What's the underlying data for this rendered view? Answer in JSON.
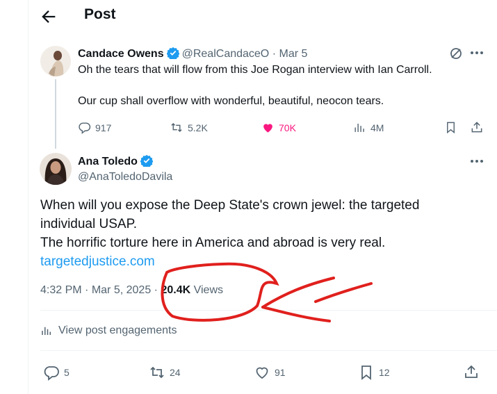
{
  "header": {
    "title": "Post",
    "back_icon": "arrow-left-icon"
  },
  "parent_post": {
    "author_name": "Candace Owens",
    "handle": "@RealCandaceO",
    "separator": "·",
    "date": "Mar 5",
    "text_line1": "Oh the tears that will flow from this Joe Rogan interview with Ian Carroll.",
    "text_line2": "Our cup shall overflow with wonderful, beautiful, neocon tears.",
    "stats": {
      "replies": "917",
      "reposts": "5.2K",
      "likes": "70K",
      "views": "4M"
    },
    "liked": true
  },
  "main_post": {
    "author_name": "Ana Toledo",
    "handle": "@AnaToledoDavila",
    "lines": [
      "When will you expose the Deep State's crown jewel: the targeted",
      "individual USAP.",
      "The horrific torture here in America and abroad is very real."
    ],
    "link_text": "targetedjustice.com",
    "time": "4:32 PM",
    "dot": "·",
    "date": "Mar 5, 2025",
    "views_count": "20.4K",
    "views_label": "Views",
    "engagements_label": "View post engagements",
    "stats": {
      "replies": "5",
      "reposts": "24",
      "likes": "91",
      "bookmarks": "12"
    }
  },
  "colors": {
    "verified": "#1d9bf0",
    "link": "#1d9bf0",
    "like_active": "#f91880",
    "muted_text": "#536471",
    "annotation": "#e0201d"
  }
}
